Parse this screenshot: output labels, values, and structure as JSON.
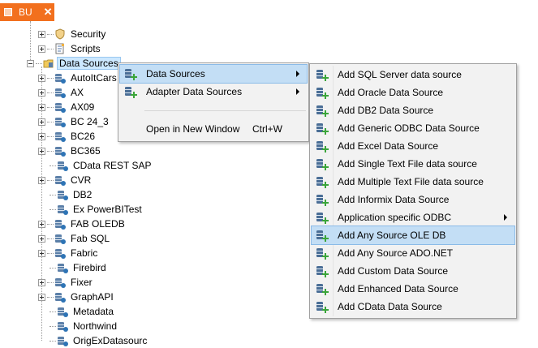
{
  "tab": {
    "label": "BU",
    "close_glyph": "✕"
  },
  "tree": {
    "top_nodes": [
      {
        "label": "Security",
        "icon": "shield-icon"
      },
      {
        "label": "Scripts",
        "icon": "scripts-icon"
      }
    ],
    "data_sources_label": "Data Sources",
    "children": [
      {
        "label": "AutoItCars",
        "expandable": true
      },
      {
        "label": "AX",
        "expandable": true
      },
      {
        "label": "AX09",
        "expandable": true
      },
      {
        "label": "BC 24_3",
        "expandable": true
      },
      {
        "label": "BC26",
        "expandable": true
      },
      {
        "label": "BC365",
        "expandable": true
      },
      {
        "label": "CData REST SAP",
        "expandable": false
      },
      {
        "label": "CVR",
        "expandable": true
      },
      {
        "label": "DB2",
        "expandable": false
      },
      {
        "label": "Ex PowerBITest",
        "expandable": false
      },
      {
        "label": "FAB OLEDB",
        "expandable": true
      },
      {
        "label": "Fab SQL",
        "expandable": true
      },
      {
        "label": "Fabric",
        "expandable": true
      },
      {
        "label": "Firebird",
        "expandable": false
      },
      {
        "label": "Fixer",
        "expandable": true
      },
      {
        "label": "GraphAPI",
        "expandable": true
      },
      {
        "label": "Metadata",
        "expandable": false
      },
      {
        "label": "Northwind",
        "expandable": false
      },
      {
        "label": "OrigExDatasourc",
        "expandable": false
      }
    ]
  },
  "context_menu": {
    "items": [
      {
        "label": "Data Sources",
        "has_submenu": true,
        "highlighted": true
      },
      {
        "label": "Adapter Data Sources",
        "has_submenu": true,
        "highlighted": false
      },
      {
        "label": "Open in New Window",
        "shortcut": "Ctrl+W",
        "has_submenu": false,
        "highlighted": false
      }
    ]
  },
  "submenu": {
    "items": [
      {
        "label": "Add SQL Server data source",
        "has_submenu": false,
        "highlighted": false
      },
      {
        "label": "Add Oracle Data Source",
        "has_submenu": false,
        "highlighted": false
      },
      {
        "label": "Add DB2 Data Source",
        "has_submenu": false,
        "highlighted": false
      },
      {
        "label": "Add Generic ODBC Data Source",
        "has_submenu": false,
        "highlighted": false
      },
      {
        "label": "Add Excel Data Source",
        "has_submenu": false,
        "highlighted": false
      },
      {
        "label": "Add Single Text File data source",
        "has_submenu": false,
        "highlighted": false
      },
      {
        "label": "Add Multiple Text File data source",
        "has_submenu": false,
        "highlighted": false
      },
      {
        "label": "Add Informix Data Source",
        "has_submenu": false,
        "highlighted": false
      },
      {
        "label": "Application specific ODBC",
        "has_submenu": true,
        "highlighted": false
      },
      {
        "label": "Add Any Source OLE DB",
        "has_submenu": false,
        "highlighted": true
      },
      {
        "label": "Add Any Source ADO.NET",
        "has_submenu": false,
        "highlighted": false
      },
      {
        "label": "Add Custom Data Source",
        "has_submenu": false,
        "highlighted": false
      },
      {
        "label": "Add Enhanced Data Source",
        "has_submenu": false,
        "highlighted": false
      },
      {
        "label": "Add CData Data Source",
        "has_submenu": false,
        "highlighted": false
      }
    ]
  },
  "colors": {
    "tab_accent": "#f2701e",
    "selection": "#cce8ff",
    "menu_highlight": "#c3def5",
    "menu_background": "#f2f2f2"
  }
}
